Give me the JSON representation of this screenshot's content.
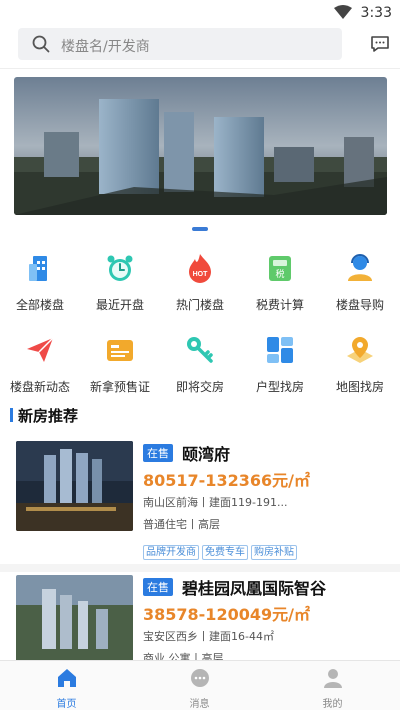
{
  "status": {
    "time": "3:33"
  },
  "search": {
    "placeholder": "楼盘名/开发商"
  },
  "categories": [
    {
      "label": "全部楼盘",
      "icon": "building-icon"
    },
    {
      "label": "最近开盘",
      "icon": "alarm-clock-icon"
    },
    {
      "label": "热门楼盘",
      "icon": "hot-fire-icon"
    },
    {
      "label": "税费计算",
      "icon": "tax-calculator-icon"
    },
    {
      "label": "楼盘导购",
      "icon": "guide-person-icon"
    },
    {
      "label": "楼盘新动态",
      "icon": "paper-plane-icon"
    },
    {
      "label": "新拿预售证",
      "icon": "certificate-icon"
    },
    {
      "label": "即将交房",
      "icon": "key-icon"
    },
    {
      "label": "户型找房",
      "icon": "floorplan-icon"
    },
    {
      "label": "地图找房",
      "icon": "map-pin-icon"
    }
  ],
  "section": {
    "title": "新房推荐"
  },
  "listings": [
    {
      "status": "在售",
      "name": "颐湾府",
      "price": "80517-132366元/㎡",
      "location": "南山区前海丨建面119-191...",
      "type": "普通住宅丨高层",
      "tags": [
        "品牌开发商",
        "免费专车",
        "购房补贴"
      ]
    },
    {
      "status": "在售",
      "name": "碧桂园凤凰国际智谷",
      "price": "38578-120049元/㎡",
      "location": "宝安区西乡丨建面16-44㎡",
      "type": "商业 公寓丨高层",
      "tags": []
    }
  ],
  "tabs": [
    {
      "label": "首页",
      "active": true
    },
    {
      "label": "消息",
      "active": false
    },
    {
      "label": "我的",
      "active": false
    }
  ],
  "colors": {
    "accent": "#2b7be0",
    "price": "#e8862a"
  }
}
